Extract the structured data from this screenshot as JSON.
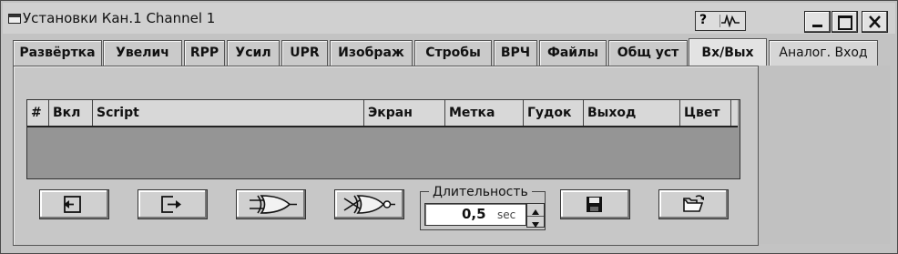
{
  "window": {
    "title": "Установки Кан.1 Channel 1",
    "help_label": "?",
    "help_icon": "help-waveform-icon",
    "controls": [
      "minimize",
      "maximize",
      "close"
    ]
  },
  "tabs": [
    {
      "label": "Развёртка",
      "active": false
    },
    {
      "label": "Увелич",
      "active": false
    },
    {
      "label": "RPP",
      "active": false
    },
    {
      "label": "Усил",
      "active": false
    },
    {
      "label": "UPR",
      "active": false
    },
    {
      "label": "Изображ",
      "active": false
    },
    {
      "label": "Стробы",
      "active": false
    },
    {
      "label": "ВРЧ",
      "active": false
    },
    {
      "label": "Файлы",
      "active": false
    },
    {
      "label": "Общ уст",
      "active": false
    },
    {
      "label": "Вх/Вых",
      "active": true
    },
    {
      "label": "Аналог. Вход",
      "active": false
    }
  ],
  "table": {
    "columns": [
      "#",
      "Вкл",
      "Script",
      "Экран",
      "Метка",
      "Гудок",
      "Выход",
      "Цвет"
    ],
    "rows": []
  },
  "toolbar": {
    "buttons": [
      "import-icon",
      "export-icon",
      "xor-gate-icon",
      "xnor-gate-icon",
      "save-icon",
      "open-folder-icon"
    ]
  },
  "duration": {
    "label": "Длительность",
    "value": "0,5",
    "unit": "sec"
  },
  "colors": {
    "window_bg": "#c3c3c3",
    "table_body": "#959595",
    "active_tab": "#e3e3e3"
  }
}
